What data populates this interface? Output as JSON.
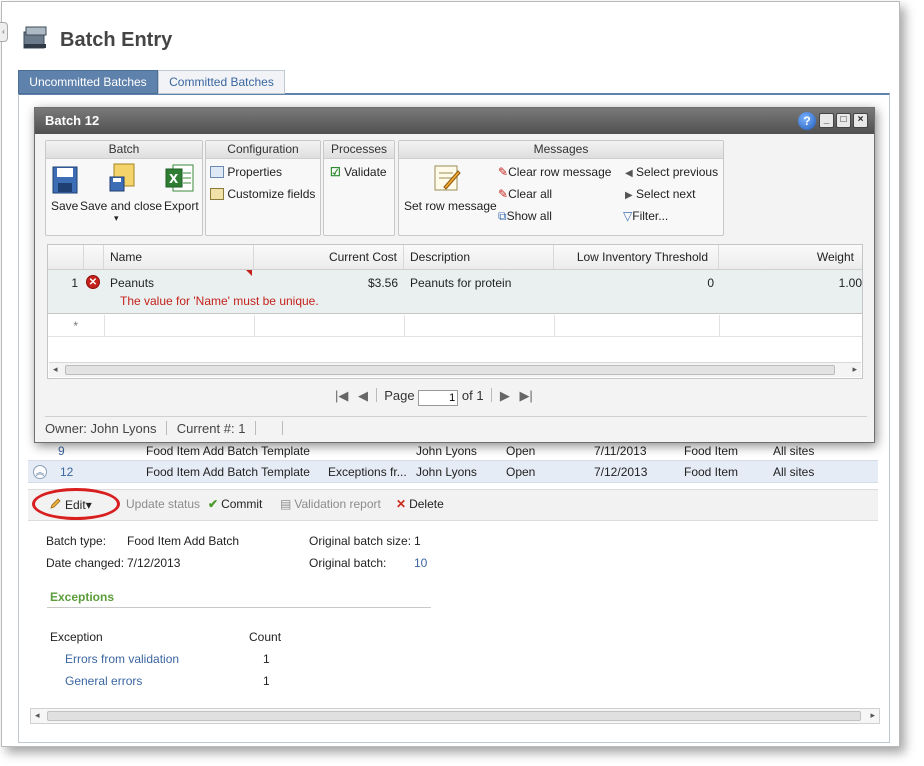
{
  "page": {
    "title": "Batch Entry",
    "tabs": [
      "Uncommitted Batches",
      "Committed Batches"
    ]
  },
  "dialog": {
    "title": "Batch 12",
    "window_buttons": [
      "?",
      "_",
      "□",
      "×"
    ],
    "ribbon": {
      "batch": {
        "header": "Batch",
        "save": "Save",
        "save_and_close": "Save and close",
        "export": "Export"
      },
      "configuration": {
        "header": "Configuration",
        "properties": "Properties",
        "customize_fields": "Customize fields"
      },
      "processes": {
        "header": "Processes",
        "validate": "Validate"
      },
      "messages": {
        "header": "Messages",
        "set_row_message": "Set row message",
        "clear_row_message": "Clear row message",
        "clear_all": "Clear all",
        "show_all": "Show all",
        "select_previous": "Select previous",
        "select_next": "Select next",
        "filter": "Filter..."
      }
    },
    "grid": {
      "columns": [
        "Name",
        "Current Cost",
        "Description",
        "Low Inventory Threshold",
        "Weight"
      ],
      "rows": [
        {
          "num": "1",
          "name": "Peanuts",
          "current_cost": "$3.56",
          "description": "Peanuts for protein",
          "low_inventory_threshold": "0",
          "weight": "1.00",
          "error": "The value for 'Name' must be unique."
        }
      ],
      "new_row_marker": "*"
    },
    "pager": {
      "page_label": "Page",
      "page_value": "1",
      "of_label": "of 1"
    },
    "status": {
      "owner": "Owner:  John Lyons",
      "current": "Current #:  1"
    }
  },
  "batches": {
    "rows": [
      {
        "num": "9",
        "template": "Food Item Add Batch Template",
        "description": "",
        "owner": "John Lyons",
        "status": "Open",
        "date": "7/11/2013",
        "type": "Food Item",
        "sites": "All sites"
      },
      {
        "num": "12",
        "template": "Food Item Add Batch Template",
        "description": "Exceptions fr...",
        "owner": "John Lyons",
        "status": "Open",
        "date": "7/12/2013",
        "type": "Food Item",
        "sites": "All sites"
      }
    ],
    "actions": {
      "edit": "Edit",
      "update_status": "Update status",
      "commit": "Commit",
      "validation_report": "Validation report",
      "delete": "Delete"
    }
  },
  "details": {
    "batch_type_label": "Batch type:",
    "batch_type_value": "Food Item Add Batch",
    "date_changed_label": "Date changed:",
    "date_changed_value": "7/12/2013",
    "original_size_label": "Original batch size:",
    "original_size_value": "1",
    "original_batch_label": "Original batch:",
    "original_batch_value": "10",
    "exceptions_title": "Exceptions",
    "exceptions_header_exception": "Exception",
    "exceptions_header_count": "Count",
    "exceptions": [
      {
        "label": "Errors from validation",
        "count": "1"
      },
      {
        "label": "General errors",
        "count": "1"
      }
    ]
  },
  "colors": {
    "tab_active": "#5f82ad",
    "link": "#3b66a0",
    "error": "#c4221c",
    "highlight_circle": "#d81e1e",
    "exceptions_heading": "#5a9d3a"
  }
}
